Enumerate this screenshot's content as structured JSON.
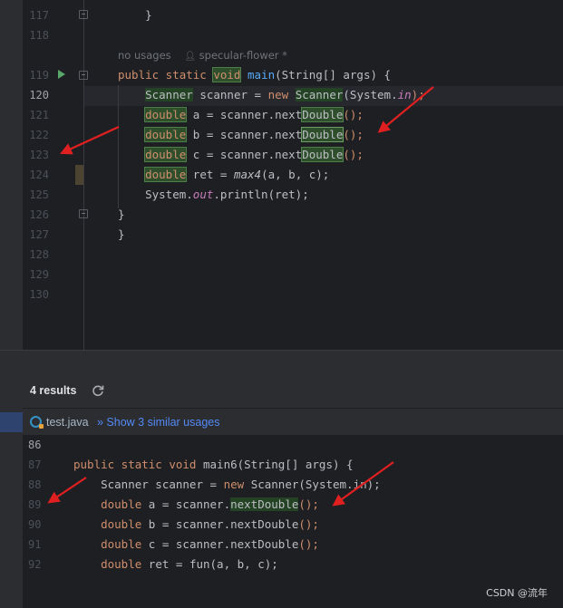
{
  "editor": {
    "lines": [
      {
        "num": "117",
        "tokens": [
          {
            "t": "    }",
            "c": ""
          }
        ]
      },
      {
        "num": "118",
        "tokens": []
      },
      {
        "num": "119",
        "tokens": [
          {
            "t": "public static ",
            "c": "kw"
          },
          {
            "t": "void",
            "c": "kw hl"
          },
          {
            "t": " ",
            "c": ""
          },
          {
            "t": "main",
            "c": "fn"
          },
          {
            "t": "(String[] args) {",
            "c": ""
          }
        ]
      },
      {
        "num": "120",
        "tokens": [
          {
            "t": "    ",
            "c": ""
          },
          {
            "t": "Scanner",
            "c": "hlg"
          },
          {
            "t": " scanner = ",
            "c": ""
          },
          {
            "t": "new ",
            "c": "kw"
          },
          {
            "t": "Scanner",
            "c": "hlg"
          },
          {
            "t": "(System.",
            "c": ""
          },
          {
            "t": "in",
            "c": "st"
          },
          {
            "t": ");",
            "c": "kw"
          }
        ]
      },
      {
        "num": "121",
        "tokens": [
          {
            "t": "    ",
            "c": ""
          },
          {
            "t": "double",
            "c": "kw hl"
          },
          {
            "t": " a = scanner.next",
            "c": ""
          },
          {
            "t": "Double",
            "c": "hl"
          },
          {
            "t": "();",
            "c": "kw"
          }
        ]
      },
      {
        "num": "122",
        "tokens": [
          {
            "t": "    ",
            "c": ""
          },
          {
            "t": "double",
            "c": "kw hl"
          },
          {
            "t": " b = scanner.next",
            "c": ""
          },
          {
            "t": "Double",
            "c": "hl hl2"
          },
          {
            "t": "();",
            "c": "kw"
          }
        ]
      },
      {
        "num": "123",
        "tokens": [
          {
            "t": "    ",
            "c": ""
          },
          {
            "t": "double",
            "c": "kw hl"
          },
          {
            "t": " c = scanner.next",
            "c": ""
          },
          {
            "t": "Double",
            "c": "hl"
          },
          {
            "t": "();",
            "c": "kw"
          }
        ]
      },
      {
        "num": "124",
        "tokens": [
          {
            "t": "    ",
            "c": ""
          },
          {
            "t": "double",
            "c": "kw hl"
          },
          {
            "t": " ret = ",
            "c": ""
          },
          {
            "t": "max4",
            "c": "it"
          },
          {
            "t": "(a, b, c);",
            "c": ""
          }
        ]
      },
      {
        "num": "125",
        "tokens": [
          {
            "t": "    System.",
            "c": ""
          },
          {
            "t": "out",
            "c": "st"
          },
          {
            "t": ".println(ret);",
            "c": ""
          }
        ]
      },
      {
        "num": "126",
        "tokens": [
          {
            "t": "}",
            "c": ""
          }
        ]
      },
      {
        "num": "127",
        "tokens": [
          {
            "t": "}",
            "c": ""
          }
        ]
      },
      {
        "num": "128",
        "tokens": []
      },
      {
        "num": "129",
        "tokens": []
      },
      {
        "num": "130",
        "tokens": []
      }
    ],
    "current_line": "120",
    "inlay_hint": {
      "usages": "no usages",
      "author": "specular-flower *"
    }
  },
  "find_panel": {
    "results_count": "4 results",
    "file_name": "test.java",
    "similar_usages": "» Show 3 similar usages",
    "preview_lines": [
      {
        "num": "86",
        "tokens": []
      },
      {
        "num": "87",
        "tokens": [
          {
            "t": "public static void ",
            "c": "kw"
          },
          {
            "t": "main6(String[] args) {",
            "c": ""
          }
        ]
      },
      {
        "num": "88",
        "tokens": [
          {
            "t": "    Scanner scanner = ",
            "c": ""
          },
          {
            "t": "new ",
            "c": "kw"
          },
          {
            "t": "Scanner(System.in);",
            "c": ""
          }
        ]
      },
      {
        "num": "89",
        "tokens": [
          {
            "t": "    ",
            "c": ""
          },
          {
            "t": "double",
            "c": "kw"
          },
          {
            "t": " a = scanner.",
            "c": ""
          },
          {
            "t": "nextDouble",
            "c": "hlg"
          },
          {
            "t": "();",
            "c": "kw"
          }
        ]
      },
      {
        "num": "90",
        "tokens": [
          {
            "t": "    ",
            "c": ""
          },
          {
            "t": "double",
            "c": "kw"
          },
          {
            "t": " b = scanner.nextDouble",
            "c": ""
          },
          {
            "t": "();",
            "c": "kw"
          }
        ]
      },
      {
        "num": "91",
        "tokens": [
          {
            "t": "    ",
            "c": ""
          },
          {
            "t": "double",
            "c": "kw"
          },
          {
            "t": " c = scanner.nextDouble",
            "c": ""
          },
          {
            "t": "();",
            "c": "kw"
          }
        ]
      },
      {
        "num": "92",
        "tokens": [
          {
            "t": "    ",
            "c": ""
          },
          {
            "t": "double",
            "c": "kw"
          },
          {
            "t": " ret = fun(a, b, c);",
            "c": ""
          }
        ]
      }
    ]
  },
  "watermark": "CSDN @流年",
  "colors": {
    "editor_bg": "#1e1f22",
    "panel_bg": "#2b2d30",
    "keyword": "#cf8e6d",
    "function": "#56a8f5",
    "static_field": "#c77dbb",
    "link": "#548af7",
    "arrow": "#e02020"
  },
  "icons": [
    "run-icon",
    "fold-icon",
    "refresh-icon",
    "java-class-icon",
    "author-icon"
  ]
}
